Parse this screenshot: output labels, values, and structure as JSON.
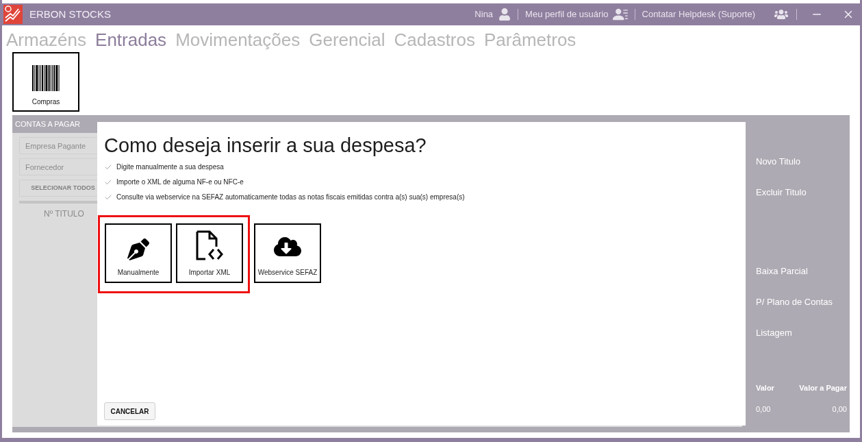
{
  "window": {
    "title": "ERBON STOCKS",
    "user": "Nina",
    "profile_link": "Meu perfil de usuário",
    "helpdesk_link": "Contatar Helpdesk (Suporte)"
  },
  "tabs": [
    {
      "label": "Armazéns",
      "selected": false
    },
    {
      "label": "Entradas",
      "selected": true
    },
    {
      "label": "Movimentações",
      "selected": false
    },
    {
      "label": "Gerencial",
      "selected": false
    },
    {
      "label": "Cadastros",
      "selected": false
    },
    {
      "label": "Parâmetros",
      "selected": false
    }
  ],
  "toolbar": [
    {
      "label": "Compras"
    }
  ],
  "background_panel": {
    "title": "CONTAS A PAGAR",
    "fields": [
      {
        "placeholder": "Empresa Pagante"
      },
      {
        "placeholder": "Fornecedor"
      }
    ],
    "select_all_button": "SELECIONAR TODOS",
    "column_header": "Nº TITULO",
    "actions": [
      {
        "label": "Novo Titulo",
        "gap_before": false
      },
      {
        "label": "Excluir Titulo",
        "gap_before": false
      },
      {
        "label": "Baixa Parcial",
        "gap_before": true
      },
      {
        "label": "P/ Plano de Contas",
        "gap_before": false
      },
      {
        "label": "Listagem",
        "gap_before": false
      }
    ],
    "totals": {
      "columns": [
        "Valor",
        "Valor a Pagar"
      ],
      "values": [
        "0,00",
        "0,00"
      ]
    }
  },
  "dialog": {
    "title": "Como deseja inserir a sua despesa?",
    "bullets": [
      "Digite manualmente a sua despesa",
      "Importe o XML de alguma NF-e ou NFC-e",
      "Consulte via webservice na SEFAZ automaticamente todas as notas fiscais emitidas contra a(s) sua(s) empresa(s)"
    ],
    "options": [
      {
        "label": "Manualmente",
        "kind": "pen",
        "highlighted": true
      },
      {
        "label": "Importar XML",
        "kind": "xml",
        "highlighted": true
      },
      {
        "label": "Webservice SEFAZ",
        "kind": "cloud",
        "highlighted": false
      }
    ],
    "cancel_button": "CANCELAR"
  }
}
